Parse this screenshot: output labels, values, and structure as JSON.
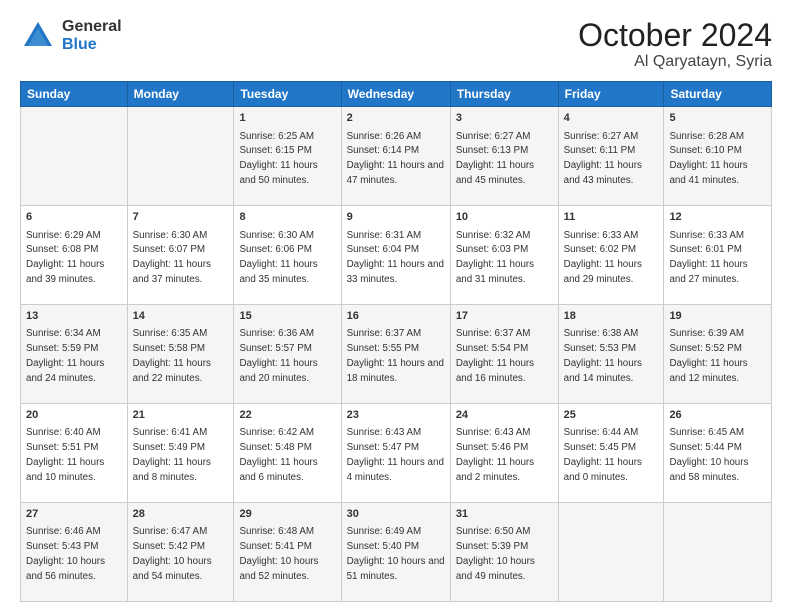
{
  "logo": {
    "general": "General",
    "blue": "Blue"
  },
  "header": {
    "month": "October 2024",
    "location": "Al Qaryatayn, Syria"
  },
  "days_of_week": [
    "Sunday",
    "Monday",
    "Tuesday",
    "Wednesday",
    "Thursday",
    "Friday",
    "Saturday"
  ],
  "weeks": [
    [
      {
        "day": "",
        "info": ""
      },
      {
        "day": "",
        "info": ""
      },
      {
        "day": "1",
        "info": "Sunrise: 6:25 AM\nSunset: 6:15 PM\nDaylight: 11 hours and 50 minutes."
      },
      {
        "day": "2",
        "info": "Sunrise: 6:26 AM\nSunset: 6:14 PM\nDaylight: 11 hours and 47 minutes."
      },
      {
        "day": "3",
        "info": "Sunrise: 6:27 AM\nSunset: 6:13 PM\nDaylight: 11 hours and 45 minutes."
      },
      {
        "day": "4",
        "info": "Sunrise: 6:27 AM\nSunset: 6:11 PM\nDaylight: 11 hours and 43 minutes."
      },
      {
        "day": "5",
        "info": "Sunrise: 6:28 AM\nSunset: 6:10 PM\nDaylight: 11 hours and 41 minutes."
      }
    ],
    [
      {
        "day": "6",
        "info": "Sunrise: 6:29 AM\nSunset: 6:08 PM\nDaylight: 11 hours and 39 minutes."
      },
      {
        "day": "7",
        "info": "Sunrise: 6:30 AM\nSunset: 6:07 PM\nDaylight: 11 hours and 37 minutes."
      },
      {
        "day": "8",
        "info": "Sunrise: 6:30 AM\nSunset: 6:06 PM\nDaylight: 11 hours and 35 minutes."
      },
      {
        "day": "9",
        "info": "Sunrise: 6:31 AM\nSunset: 6:04 PM\nDaylight: 11 hours and 33 minutes."
      },
      {
        "day": "10",
        "info": "Sunrise: 6:32 AM\nSunset: 6:03 PM\nDaylight: 11 hours and 31 minutes."
      },
      {
        "day": "11",
        "info": "Sunrise: 6:33 AM\nSunset: 6:02 PM\nDaylight: 11 hours and 29 minutes."
      },
      {
        "day": "12",
        "info": "Sunrise: 6:33 AM\nSunset: 6:01 PM\nDaylight: 11 hours and 27 minutes."
      }
    ],
    [
      {
        "day": "13",
        "info": "Sunrise: 6:34 AM\nSunset: 5:59 PM\nDaylight: 11 hours and 24 minutes."
      },
      {
        "day": "14",
        "info": "Sunrise: 6:35 AM\nSunset: 5:58 PM\nDaylight: 11 hours and 22 minutes."
      },
      {
        "day": "15",
        "info": "Sunrise: 6:36 AM\nSunset: 5:57 PM\nDaylight: 11 hours and 20 minutes."
      },
      {
        "day": "16",
        "info": "Sunrise: 6:37 AM\nSunset: 5:55 PM\nDaylight: 11 hours and 18 minutes."
      },
      {
        "day": "17",
        "info": "Sunrise: 6:37 AM\nSunset: 5:54 PM\nDaylight: 11 hours and 16 minutes."
      },
      {
        "day": "18",
        "info": "Sunrise: 6:38 AM\nSunset: 5:53 PM\nDaylight: 11 hours and 14 minutes."
      },
      {
        "day": "19",
        "info": "Sunrise: 6:39 AM\nSunset: 5:52 PM\nDaylight: 11 hours and 12 minutes."
      }
    ],
    [
      {
        "day": "20",
        "info": "Sunrise: 6:40 AM\nSunset: 5:51 PM\nDaylight: 11 hours and 10 minutes."
      },
      {
        "day": "21",
        "info": "Sunrise: 6:41 AM\nSunset: 5:49 PM\nDaylight: 11 hours and 8 minutes."
      },
      {
        "day": "22",
        "info": "Sunrise: 6:42 AM\nSunset: 5:48 PM\nDaylight: 11 hours and 6 minutes."
      },
      {
        "day": "23",
        "info": "Sunrise: 6:43 AM\nSunset: 5:47 PM\nDaylight: 11 hours and 4 minutes."
      },
      {
        "day": "24",
        "info": "Sunrise: 6:43 AM\nSunset: 5:46 PM\nDaylight: 11 hours and 2 minutes."
      },
      {
        "day": "25",
        "info": "Sunrise: 6:44 AM\nSunset: 5:45 PM\nDaylight: 11 hours and 0 minutes."
      },
      {
        "day": "26",
        "info": "Sunrise: 6:45 AM\nSunset: 5:44 PM\nDaylight: 10 hours and 58 minutes."
      }
    ],
    [
      {
        "day": "27",
        "info": "Sunrise: 6:46 AM\nSunset: 5:43 PM\nDaylight: 10 hours and 56 minutes."
      },
      {
        "day": "28",
        "info": "Sunrise: 6:47 AM\nSunset: 5:42 PM\nDaylight: 10 hours and 54 minutes."
      },
      {
        "day": "29",
        "info": "Sunrise: 6:48 AM\nSunset: 5:41 PM\nDaylight: 10 hours and 52 minutes."
      },
      {
        "day": "30",
        "info": "Sunrise: 6:49 AM\nSunset: 5:40 PM\nDaylight: 10 hours and 51 minutes."
      },
      {
        "day": "31",
        "info": "Sunrise: 6:50 AM\nSunset: 5:39 PM\nDaylight: 10 hours and 49 minutes."
      },
      {
        "day": "",
        "info": ""
      },
      {
        "day": "",
        "info": ""
      }
    ]
  ]
}
